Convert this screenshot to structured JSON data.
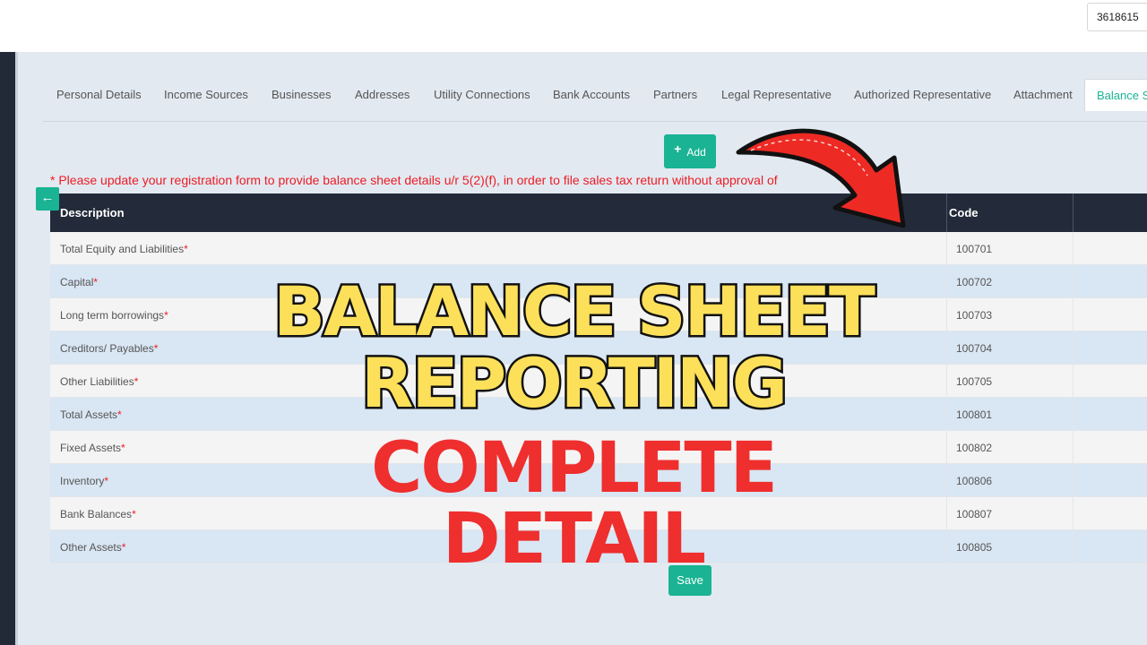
{
  "header": {
    "user_id": "3618615"
  },
  "tabs": [
    {
      "label": "Personal Details"
    },
    {
      "label": "Income Sources"
    },
    {
      "label": "Businesses"
    },
    {
      "label": "Addresses"
    },
    {
      "label": "Utility Connections"
    },
    {
      "label": "Bank Accounts"
    },
    {
      "label": "Partners"
    },
    {
      "label": "Legal Representative"
    },
    {
      "label": "Authorized Representative"
    },
    {
      "label": "Attachment"
    },
    {
      "label": "Balance Sheet",
      "active": true
    }
  ],
  "toolbar": {
    "add_label": "Add",
    "save_label": "Save"
  },
  "notice": "* Please update your registration form to provide balance sheet details u/r 5(2)(f), in order to file sales tax return without approval of",
  "table": {
    "headers": [
      "Description",
      "Code"
    ],
    "rows": [
      {
        "description": "Total Equity and Liabilities",
        "required": "*",
        "code": "100701"
      },
      {
        "description": "Capital",
        "required": "*",
        "code": "100702"
      },
      {
        "description": "Long term borrowings",
        "required": "*",
        "code": "100703"
      },
      {
        "description": "Creditors/ Payables",
        "required": "*",
        "code": "100704"
      },
      {
        "description": "Other Liabilities",
        "required": "*",
        "code": "100705"
      },
      {
        "description": "Total Assets",
        "required": "*",
        "code": "100801"
      },
      {
        "description": "Fixed Assets",
        "required": "*",
        "code": "100802"
      },
      {
        "description": "Inventory",
        "required": "*",
        "code": "100806"
      },
      {
        "description": "Bank Balances",
        "required": "*",
        "code": "100807"
      },
      {
        "description": "Other Assets",
        "required": "*",
        "code": "100805"
      }
    ]
  },
  "overlay": {
    "line1": "BALANCE SHEET",
    "line2": "REPORTING",
    "line3": "COMPLETE",
    "line4": "DETAIL"
  },
  "colors": {
    "accent": "#1ab394",
    "required": "#ed1c24",
    "header_dark": "#232b3a",
    "overlay_yellow": "#fde05a",
    "overlay_red": "#ef2e2e"
  },
  "icons": {
    "add": "plus-icon",
    "back": "arrow-left-icon",
    "pointer": "red-curved-arrow-icon"
  }
}
